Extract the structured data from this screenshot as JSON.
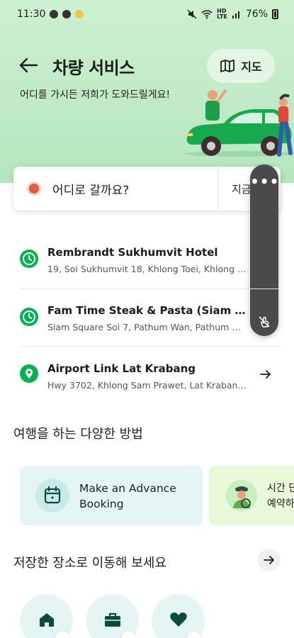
{
  "status_bar": {
    "time": "11:30",
    "battery": "76%"
  },
  "header": {
    "title": "차량 서비스",
    "map_label": "지도",
    "subtitle": "어디를 가시든 저희가 도와드릴게요!"
  },
  "search": {
    "placeholder_label": "어디로 갈까요?",
    "time_label": "지금"
  },
  "recent_places": [
    {
      "name": "Rembrandt Sukhumvit Hotel",
      "address": "19, Soi Sukhumvit 18, Khlong Toei, Khlong T...",
      "icon": "clock-icon"
    },
    {
      "name": "Fam Time Steak & Pasta (Siam Squar...",
      "address": "Siam Square Soi 7, Pathum Wan, Pathum W...",
      "icon": "clock-icon"
    },
    {
      "name": "Airport Link Lat Krabang",
      "address": "Hwy 3702, Khlong Sam Prawet, Lat Krabang,...",
      "icon": "pin-icon"
    }
  ],
  "ways_section": {
    "title": "여행을 하는 다양한 방법",
    "cards": [
      {
        "line1": "Make an Advance",
        "line2": "Booking"
      },
      {
        "line1": "시간 단",
        "line2": "예약하"
      }
    ]
  },
  "saved_section": {
    "title": "저장한 장소로 이동해 보세요"
  },
  "colors": {
    "brand_green": "#00b14f",
    "hero_bg": "#c4ecca",
    "dark_green": "#0c4a3a"
  }
}
